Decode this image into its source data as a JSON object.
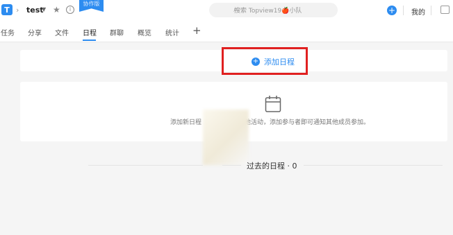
{
  "header": {
    "project_name": "test",
    "ribbon_label": "协作版",
    "search_placeholder": "搜索 Topview19🍎小队",
    "mine_label": "我的"
  },
  "tabs": [
    "任务",
    "分享",
    "文件",
    "日程",
    "群聊",
    "概览",
    "统计"
  ],
  "active_tab": "日程",
  "schedule": {
    "add_label": "添加日程",
    "empty_text_left": "添加新日程",
    "empty_text_right": "他活动，添加参与者即可通知其他成员参加。",
    "past_label": "过去的日程 · 0"
  },
  "icons": {
    "logo": "app-logo-icon",
    "search": "search-icon",
    "calendar": "calendar-icon"
  },
  "colors": {
    "accent": "#2d8cf0",
    "highlight": "#e02020"
  }
}
